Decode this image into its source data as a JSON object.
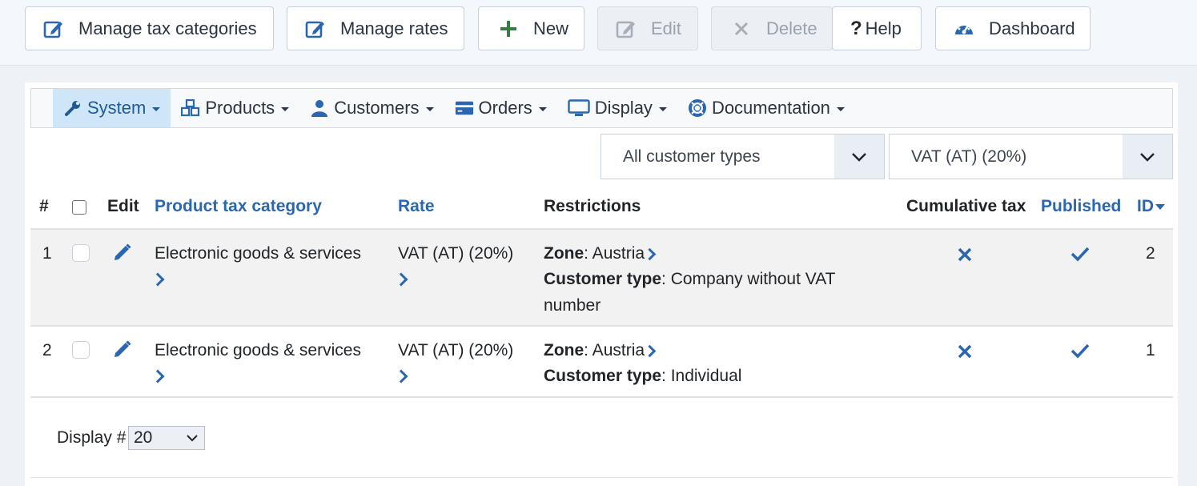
{
  "toolbar": {
    "manage_tax_categories": "Manage tax categories",
    "manage_rates": "Manage rates",
    "new": "New",
    "edit": "Edit",
    "delete": "Delete",
    "help": "Help",
    "dashboard": "Dashboard"
  },
  "menu": {
    "system": "System",
    "products": "Products",
    "customers": "Customers",
    "orders": "Orders",
    "display": "Display",
    "documentation": "Documentation"
  },
  "filters": {
    "customer_type": "All customer types",
    "rate": "VAT (AT) (20%)"
  },
  "table": {
    "headers": {
      "num": "#",
      "edit": "Edit",
      "category": "Product tax category",
      "rate": "Rate",
      "restrictions": "Restrictions",
      "cumulative": "Cumulative tax",
      "published": "Published",
      "id": "ID"
    },
    "rows": [
      {
        "num": "1",
        "category": "Electronic goods & services",
        "rate": "VAT (AT) (20%)",
        "zone_label": "Zone",
        "zone": ": Austria",
        "ctype_label": "Customer type",
        "ctype_1": ": Company without VAT",
        "ctype_2": "number",
        "id": "2"
      },
      {
        "num": "2",
        "category": "Electronic goods & services",
        "rate": "VAT (AT) (20%)",
        "zone_label": "Zone",
        "zone": ": Austria",
        "ctype_label": "Customer type",
        "ctype_1": ": Individual",
        "id": "1"
      }
    ]
  },
  "footer": {
    "display_label": "Display #",
    "display_value": "20"
  },
  "colors": {
    "accent": "#2b67b0",
    "active_menu": "#cfe6f8",
    "new_icon": "#3a7d44"
  }
}
